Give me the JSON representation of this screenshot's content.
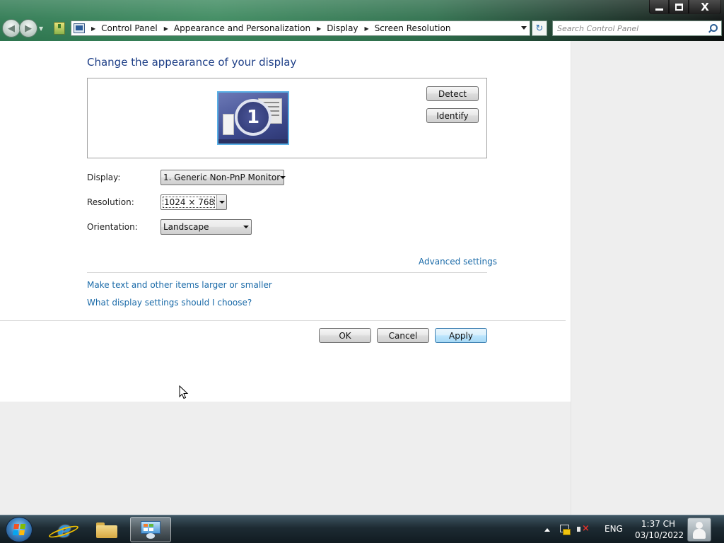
{
  "window": {
    "minimize_glyph": "minimize-icon",
    "maximize_glyph": "restore-icon",
    "close_label": "X"
  },
  "navigation": {
    "back_icon": "back-arrow-icon",
    "forward_icon": "forward-arrow-icon",
    "breadcrumbs": [
      "Control Panel",
      "Appearance and Personalization",
      "Display",
      "Screen Resolution"
    ],
    "search_placeholder": "Search Control Panel"
  },
  "page": {
    "heading": "Change the appearance of your display",
    "monitor_number": "1",
    "detect_label": "Detect",
    "identify_label": "Identify"
  },
  "settings": {
    "display_label": "Display:",
    "display_value": "1. Generic Non-PnP Monitor",
    "resolution_label": "Resolution:",
    "resolution_value": "1024 × 768",
    "orientation_label": "Orientation:",
    "orientation_value": "Landscape"
  },
  "links": {
    "advanced_settings": "Advanced settings",
    "text_size": "Make text and other items larger or smaller",
    "which_settings": "What display settings should I choose?"
  },
  "buttons": {
    "ok": "OK",
    "cancel": "Cancel",
    "apply": "Apply"
  },
  "taskbar": {
    "pinned": [
      "internet-explorer-icon",
      "file-explorer-icon",
      "control-panel-icon"
    ],
    "language": "ENG",
    "time": "1:37 CH",
    "date": "03/10/2022"
  },
  "colors": {
    "heading": "#1e3f87",
    "link": "#1a6aa8",
    "default_button": "#a7d9f5"
  }
}
